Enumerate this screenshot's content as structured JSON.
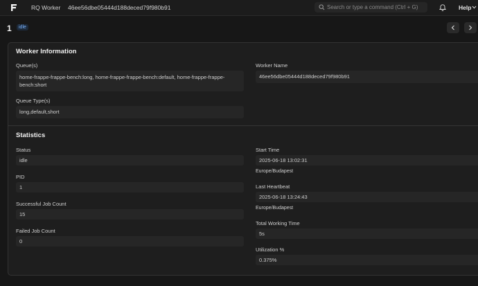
{
  "navbar": {
    "app_name": "RQ Worker",
    "record_name": "46ee56dbe05444d188deced79f980b91",
    "search_placeholder": "Search or type a command (Ctrl + G)",
    "help_label": "Help"
  },
  "page": {
    "title": "1",
    "status": "idle"
  },
  "worker_info": {
    "section_title": "Worker Information",
    "queues_label": "Queue(s)",
    "queues_value": "home-frappe-frappe-bench:long, home-frappe-frappe-bench:default, home-frappe-frappe-bench:short",
    "queue_types_label": "Queue Type(s)",
    "queue_types_value": "long,default,short",
    "worker_name_label": "Worker Name",
    "worker_name_value": "46ee56dbe05444d188deced79f980b91"
  },
  "statistics": {
    "section_title": "Statistics",
    "status_label": "Status",
    "status_value": "idle",
    "pid_label": "PID",
    "pid_value": "1",
    "successful_label": "Successful Job Count",
    "successful_value": "15",
    "failed_label": "Failed Job Count",
    "failed_value": "0",
    "start_time_label": "Start Time",
    "start_time_value": "2025-06-18 13:02:31",
    "start_time_tz": "Europe/Budapest",
    "heartbeat_label": "Last Heartbeat",
    "heartbeat_value": "2025-06-18 13:24:43",
    "heartbeat_tz": "Europe/Budapest",
    "working_time_label": "Total Working Time",
    "working_time_value": "5s",
    "utilization_label": "Utilization %",
    "utilization_value": "0.375%"
  },
  "icons": {
    "logo": "frappe-logo-icon",
    "search": "search-icon",
    "bell": "bell-icon",
    "help_chevron": "chevron-down-icon",
    "prev": "chevron-left-icon",
    "next": "chevron-right-icon"
  }
}
